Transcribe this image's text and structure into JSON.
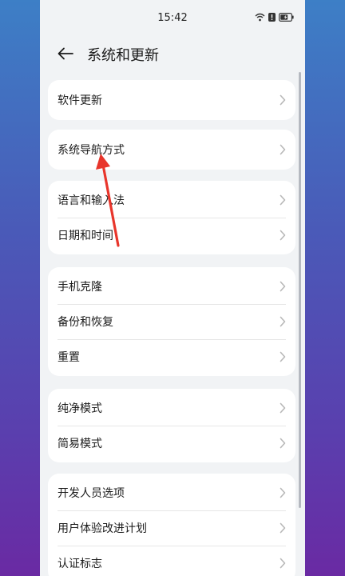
{
  "status_bar": {
    "time": "15:42"
  },
  "header": {
    "title": "系统和更新"
  },
  "groups": [
    {
      "items": [
        {
          "label": "软件更新"
        }
      ]
    },
    {
      "items": [
        {
          "label": "系统导航方式"
        }
      ]
    },
    {
      "items": [
        {
          "label": "语言和输入法"
        },
        {
          "label": "日期和时间"
        }
      ]
    },
    {
      "items": [
        {
          "label": "手机克隆"
        },
        {
          "label": "备份和恢复"
        },
        {
          "label": "重置"
        }
      ]
    },
    {
      "items": [
        {
          "label": "纯净模式"
        },
        {
          "label": "简易模式"
        }
      ]
    },
    {
      "items": [
        {
          "label": "开发人员选项"
        },
        {
          "label": "用户体验改进计划"
        },
        {
          "label": "认证标志"
        }
      ]
    }
  ],
  "icons": {
    "back": "back-arrow-icon",
    "chevron": "chevron-right-icon",
    "wifi": "wifi-icon",
    "alert": "alert-icon",
    "battery": "battery-charging-icon"
  },
  "colors": {
    "annotation_arrow": "#e8352b",
    "chevron": "#b8b8b8"
  }
}
